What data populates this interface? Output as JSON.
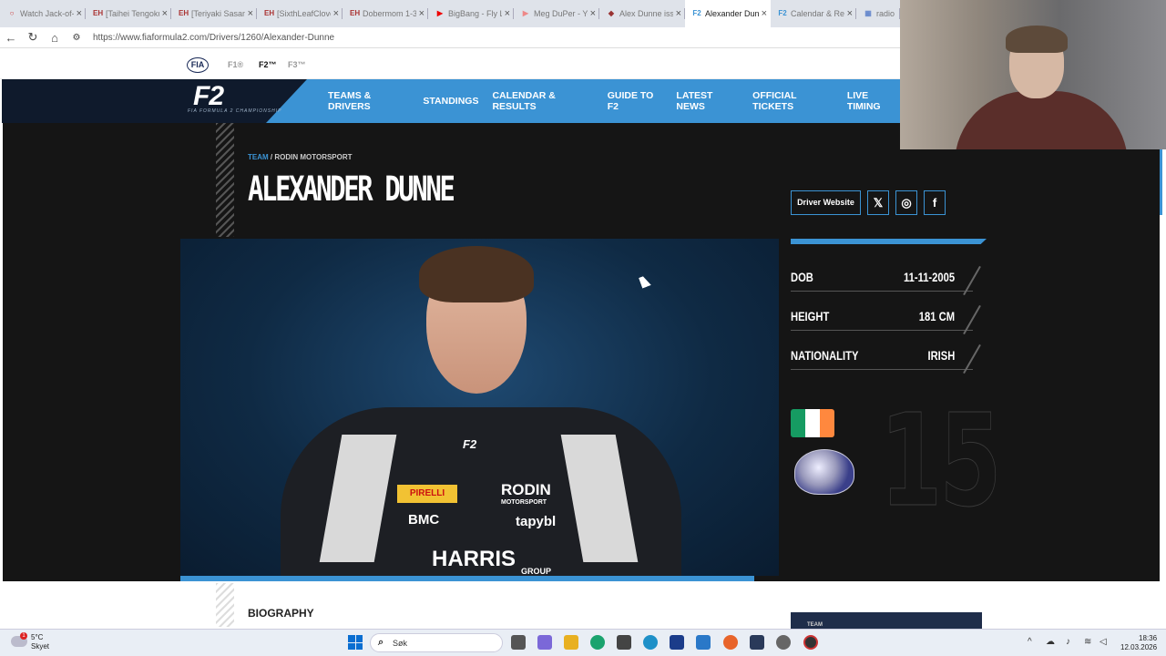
{
  "browser": {
    "tabs": [
      {
        "label": "Watch Jack-of-",
        "fav": "○",
        "color": "#c33"
      },
      {
        "label": "[Taihei Tengoku",
        "fav": "EH",
        "color": "#a33"
      },
      {
        "label": "[Teriyaki Sasam",
        "fav": "EH",
        "color": "#a33"
      },
      {
        "label": "[SixthLeafClove",
        "fav": "EH",
        "color": "#a33"
      },
      {
        "label": "Dobermom 1-3",
        "fav": "EH",
        "color": "#a33"
      },
      {
        "label": "BigBang - Fly Li",
        "fav": "▶",
        "color": "#e00"
      },
      {
        "label": "Meg DuPer - Yo",
        "fav": "▶",
        "color": "#e88"
      },
      {
        "label": "Alex Dunne issu",
        "fav": "◆",
        "color": "#933"
      },
      {
        "label": "Alexander Dunn",
        "fav": "F2",
        "color": "#3b93d4",
        "active": true
      },
      {
        "label": "Calendar & Res",
        "fav": "F2",
        "color": "#3b93d4"
      },
      {
        "label": "radio",
        "fav": "▦",
        "color": "#68c"
      }
    ],
    "url": "https://www.fiaformula2.com/Drivers/1260/Alexander-Dunne"
  },
  "fia": {
    "logo": "FIA",
    "series": [
      "F1®",
      "F2™",
      "F3™"
    ]
  },
  "nav": {
    "logo": "F2",
    "logo_sub": "FIA FORMULA 2 CHAMPIONSHIP",
    "items": [
      "TEAMS & DRIVERS",
      "STANDINGS",
      "CALENDAR & RESULTS",
      "GUIDE TO F2",
      "LATEST NEWS",
      "OFFICIAL TICKETS",
      "LIVE TIMING"
    ]
  },
  "driver": {
    "crumb_team": "TEAM",
    "crumb_sep": " / ",
    "crumb_name": "RODIN MOTORSPORT",
    "name": "ALEXANDER DUNNE",
    "website_label": "Driver Website",
    "stats": [
      {
        "label": "DOB",
        "value": "11-11-2005"
      },
      {
        "label": "HEIGHT",
        "value": "181 CM"
      },
      {
        "label": "NATIONALITY",
        "value": "IRISH"
      }
    ],
    "number": "15",
    "flag_colors": [
      "#169b62",
      "#ffffff",
      "#ff883e"
    ],
    "sponsors": {
      "pirelli": "PIRELLI",
      "rodin": "RODIN",
      "motorsport": "MOTORSPORT",
      "bmc": "BMC",
      "tapybl": "tapybl",
      "harris": "HARRIS",
      "group": "GROUP",
      "suit_f2": "F2"
    }
  },
  "bio": {
    "heading": "BIOGRAPHY",
    "team_label": "TEAM"
  },
  "taskbar": {
    "temp": "5°C",
    "weather": "Skyet",
    "badge": "1",
    "search_placeholder": "Søk",
    "time": "18:36",
    "date": "12.03.2026"
  }
}
